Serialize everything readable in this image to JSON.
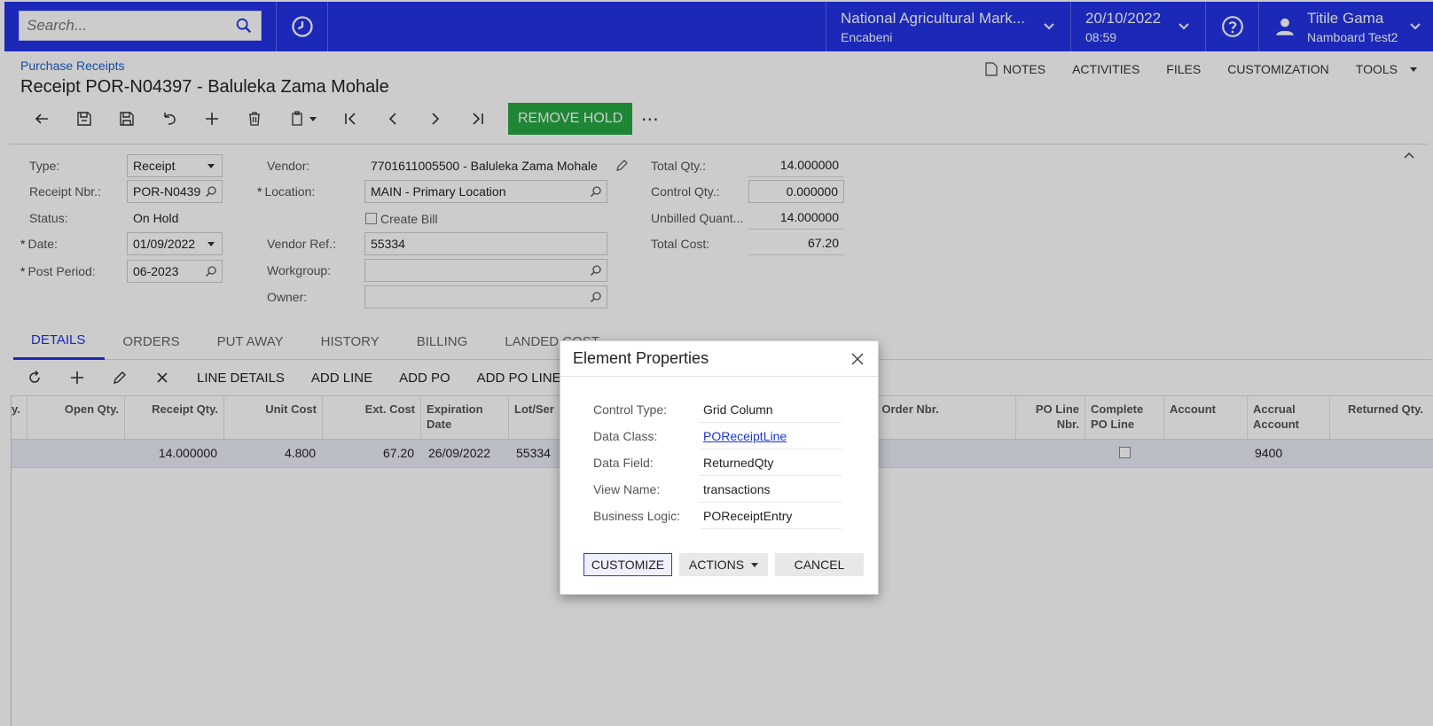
{
  "topbar": {
    "search_placeholder": "Search...",
    "company_name": "National Agricultural Mark...",
    "branch": "Encabeni",
    "date": "20/10/2022",
    "time": "08:59",
    "user_name": "Titile Gama",
    "user_tenant": "Namboard Test2"
  },
  "page": {
    "breadcrumb": "Purchase Receipts",
    "title": "Receipt POR-N04397 - Baluleka Zama Mohale",
    "links": {
      "notes": "NOTES",
      "activities": "ACTIVITIES",
      "files": "FILES",
      "customization": "CUSTOMIZATION",
      "tools": "TOOLS"
    },
    "remove_hold": "REMOVE HOLD",
    "more": "⋯"
  },
  "form": {
    "type_label": "Type:",
    "type_value": "Receipt",
    "receipt_nbr_label": "Receipt Nbr.:",
    "receipt_nbr_value": "POR-N0439",
    "status_label": "Status:",
    "status_value": "On Hold",
    "date_label": "Date:",
    "date_value": "01/09/2022",
    "post_period_label": "Post Period:",
    "post_period_value": "06-2023",
    "vendor_label": "Vendor:",
    "vendor_value": "7701611005500 - Baluleka Zama Mohale",
    "location_label": "Location:",
    "location_value": "MAIN - Primary Location",
    "create_bill_label": "Create Bill",
    "vendor_ref_label": "Vendor Ref.:",
    "vendor_ref_value": "55334",
    "workgroup_label": "Workgroup:",
    "workgroup_value": "",
    "owner_label": "Owner:",
    "owner_value": "",
    "total_qty_label": "Total Qty.:",
    "total_qty_value": "14.000000",
    "control_qty_label": "Control Qty.:",
    "control_qty_value": "0.000000",
    "unbilled_label": "Unbilled Quant...",
    "unbilled_value": "14.000000",
    "total_cost_label": "Total Cost:",
    "total_cost_value": "67.20",
    "required_mark": "*"
  },
  "tabs": [
    "DETAILS",
    "ORDERS",
    "PUT AWAY",
    "HISTORY",
    "BILLING",
    "LANDED COST"
  ],
  "grid_toolbar": {
    "line_details": "LINE DETAILS",
    "add_line": "ADD LINE",
    "add_po": "ADD PO",
    "add_po_line": "ADD PO LINE"
  },
  "grid": {
    "headers": {
      "qty_partial": "y.",
      "open_qty": "Open Qty.",
      "receipt_qty": "Receipt Qty.",
      "unit_cost": "Unit Cost",
      "ext_cost": "Ext. Cost",
      "expiration_date": "Expiration Date",
      "lot_serial": "Lot/Ser",
      "po_order_nbr": "PO Order Nbr.",
      "po_line_nbr": "PO Line Nbr.",
      "complete_po_line": "Complete PO Line",
      "account": "Account",
      "accrual_account": "Accrual Account",
      "returned_qty": "Returned Qty."
    },
    "row": {
      "receipt_qty": "14.000000",
      "unit_cost": "4.800",
      "ext_cost": "67.20",
      "expiration_date": "26/09/2022",
      "lot_serial": "55334",
      "accrual_account": "9400"
    }
  },
  "dialog": {
    "title": "Element Properties",
    "properties": [
      {
        "label": "Control Type:",
        "value": "Grid Column"
      },
      {
        "label": "Data Class:",
        "value": "POReceiptLine"
      },
      {
        "label": "Data Field:",
        "value": "ReturnedQty"
      },
      {
        "label": "View Name:",
        "value": "transactions"
      },
      {
        "label": "Business Logic:",
        "value": "POReceiptEntry"
      }
    ],
    "buttons": {
      "customize": "CUSTOMIZE",
      "actions": "ACTIONS",
      "cancel": "CANCEL"
    }
  },
  "colors": {
    "brand": "#2233e6",
    "success": "#27a844",
    "link": "#1b62c9"
  }
}
